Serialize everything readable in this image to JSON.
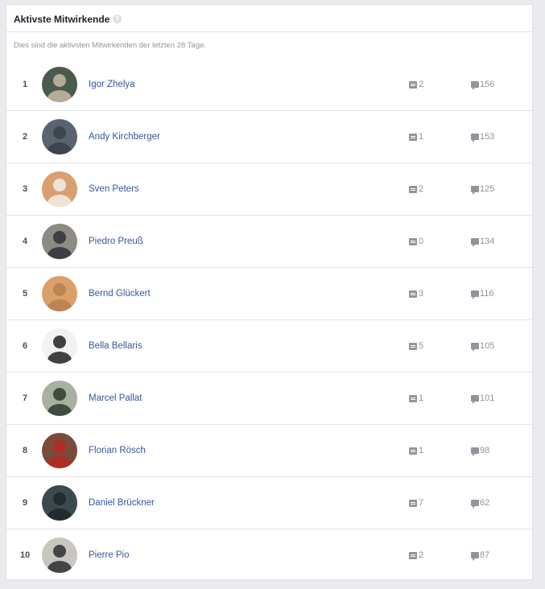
{
  "header": {
    "title": "Aktivste Mitwirkende",
    "help_glyph": "?"
  },
  "subtitle": "Dies sind die aktivsten Mitwirkenden der letzten 28 Tage.",
  "contributors": [
    {
      "rank": "1",
      "name": "Igor Zhelya",
      "posts": "2",
      "comments": "156",
      "avatar_colors": [
        "#4a5a4e",
        "#c9b9a6"
      ]
    },
    {
      "rank": "2",
      "name": "Andy Kirchberger",
      "posts": "1",
      "comments": "153",
      "avatar_colors": [
        "#5a6470",
        "#3b3f45"
      ]
    },
    {
      "rank": "3",
      "name": "Sven Peters",
      "posts": "2",
      "comments": "125",
      "avatar_colors": [
        "#d8a070",
        "#f3efe8"
      ]
    },
    {
      "rank": "4",
      "name": "Piedro Preuß",
      "posts": "0",
      "comments": "134",
      "avatar_colors": [
        "#8e8a84",
        "#2f3236"
      ]
    },
    {
      "rank": "5",
      "name": "Bernd Glückert",
      "posts": "3",
      "comments": "116",
      "avatar_colors": [
        "#d9a06b",
        "#b97e4f"
      ]
    },
    {
      "rank": "6",
      "name": "Bella Bellaris",
      "posts": "5",
      "comments": "105",
      "avatar_colors": [
        "#f2f2f2",
        "#222222"
      ]
    },
    {
      "rank": "7",
      "name": "Marcel Pallat",
      "posts": "1",
      "comments": "101",
      "avatar_colors": [
        "#a8b0a0",
        "#2d3b2f"
      ]
    },
    {
      "rank": "8",
      "name": "Florian Rösch",
      "posts": "1",
      "comments": "98",
      "avatar_colors": [
        "#7a4a3a",
        "#b7281f"
      ]
    },
    {
      "rank": "9",
      "name": "Daniel Brückner",
      "posts": "7",
      "comments": "62",
      "avatar_colors": [
        "#3c4a4d",
        "#20262a"
      ]
    },
    {
      "rank": "10",
      "name": "Pierre Pio",
      "posts": "2",
      "comments": "87",
      "avatar_colors": [
        "#c9c6c0",
        "#2a2d33"
      ]
    }
  ],
  "icons": {
    "posts": "post-icon",
    "comments": "comment-icon"
  },
  "colors": {
    "link": "#365899",
    "muted": "#90949c",
    "background": "#e9ebee"
  }
}
